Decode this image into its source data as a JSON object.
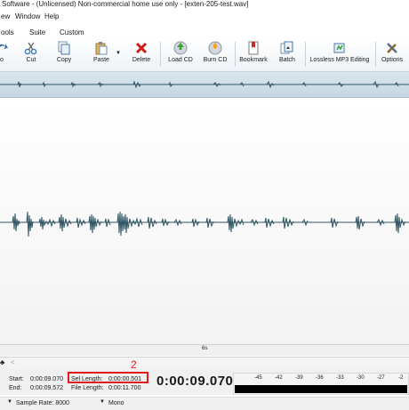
{
  "window": {
    "title": "Software - (Unlicensed) Non-commercial home use only - [exten-205-test.wav]"
  },
  "menu": [
    "ew",
    "Window",
    "Help"
  ],
  "tabs": [
    "ools",
    "Suite",
    "Custom"
  ],
  "toolbar": {
    "buttons": [
      {
        "label": "o",
        "icon": "redo-icon"
      },
      {
        "label": "Cut",
        "icon": "scissors-icon"
      },
      {
        "label": "Copy",
        "icon": "copy-icon"
      },
      {
        "label": "Paste",
        "icon": "paste-icon"
      },
      {
        "label": "Delete",
        "icon": "delete-x-icon"
      },
      {
        "label": "Load CD",
        "icon": "load-cd-icon"
      },
      {
        "label": "Burn CD",
        "icon": "burn-cd-icon"
      },
      {
        "label": "Bookmark",
        "icon": "bookmark-icon"
      },
      {
        "label": "Batch",
        "icon": "batch-icon"
      },
      {
        "label": "Lossless MP3 Editing",
        "icon": "lossless-mp3-icon"
      },
      {
        "label": "Options",
        "icon": "options-tools-icon"
      }
    ]
  },
  "ruler": {
    "tick_label": "6s"
  },
  "selection": {
    "start_label": "Start:",
    "start_value": "0:00:09.070",
    "end_label": "End:",
    "end_value": "0:00:09.572",
    "sel_length_label": "Sel Length:",
    "sel_length_value": "0:00:00.501",
    "file_length_label": "File Length:",
    "file_length_value": "0:00:11.700"
  },
  "current_time": "0:00:09.070",
  "meter": {
    "scale": [
      "-45",
      "-42",
      "-39",
      "-36",
      "-33",
      "-30",
      "-27",
      "-2"
    ]
  },
  "footer": {
    "sample_rate": "Sample Rate: 8000",
    "channels": "Mono"
  },
  "annotation": {
    "number": "2",
    "color": "#e11b1b"
  },
  "colors": {
    "waveform": "#2f5564",
    "overview_bg": "#cfdfe8",
    "highlight_box": "#e11b1b"
  }
}
